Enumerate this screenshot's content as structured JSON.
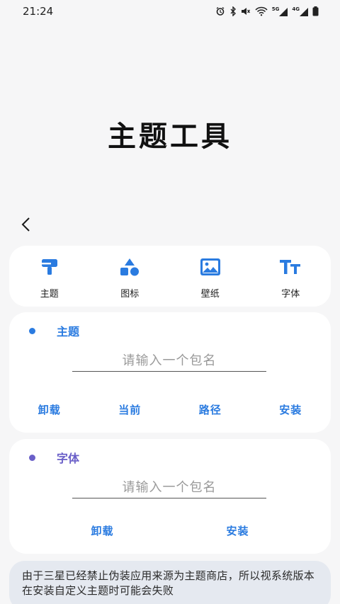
{
  "status_bar": {
    "time": "21:24",
    "icons": [
      "alarm-icon",
      "bluetooth-icon",
      "mute-icon",
      "wifi-icon",
      "signal-5g-icon",
      "signal-4g-icon",
      "battery-icon"
    ],
    "net1": "5G",
    "net2": "4G"
  },
  "page": {
    "title": "主题工具"
  },
  "tabs": [
    {
      "label": "主题",
      "icon": "brush-icon"
    },
    {
      "label": "图标",
      "icon": "shapes-icon"
    },
    {
      "label": "壁纸",
      "icon": "image-icon"
    },
    {
      "label": "字体",
      "icon": "font-size-icon"
    }
  ],
  "theme_section": {
    "title": "主题",
    "dot_color": "#2a7be0",
    "placeholder": "请输入一个包名",
    "value": "",
    "actions": [
      "卸载",
      "当前",
      "路径",
      "安装"
    ]
  },
  "font_section": {
    "title": "字体",
    "dot_color": "#6a5fc8",
    "placeholder": "请输入一个包名",
    "value": "",
    "actions": [
      "卸载",
      "安装"
    ]
  },
  "notice": {
    "text": "由于三星已经禁止伪装应用来源为主题商店，所以视系统版本在安装自定义主题时可能会失败"
  },
  "colors": {
    "accent": "#2a7be0",
    "font_accent": "#6a5fc8",
    "card_bg": "#ffffff",
    "page_bg": "#f6f6f7",
    "notice_bg": "#e5e9f0"
  }
}
